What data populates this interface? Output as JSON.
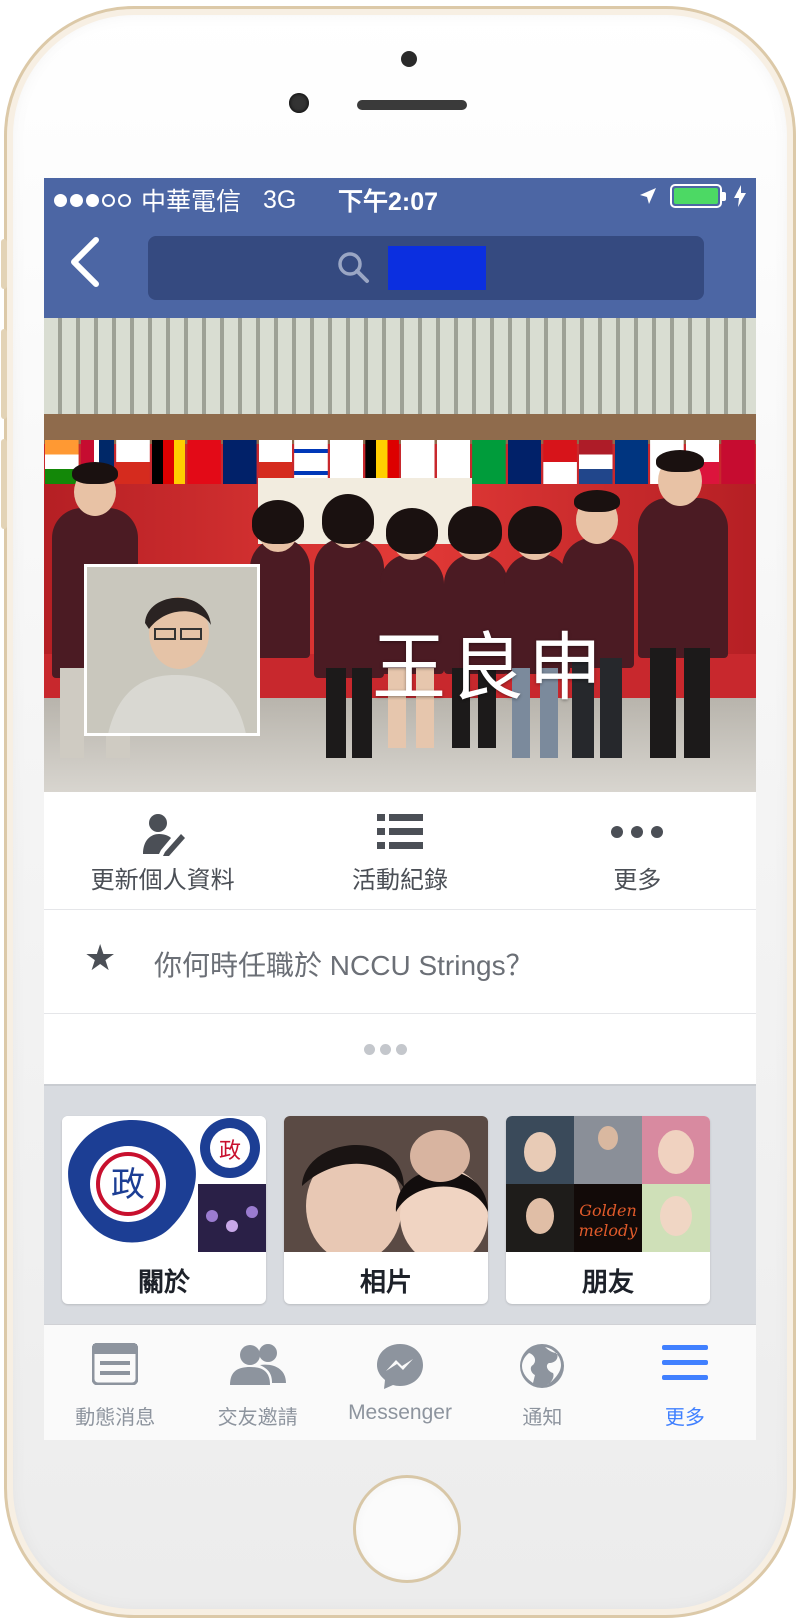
{
  "status_bar": {
    "carrier": "中華電信",
    "network": "3G",
    "time": "下午2:07",
    "signal_bars_filled": 3,
    "signal_bars_total": 5,
    "battery_level": 1.0
  },
  "nav": {
    "back_icon": "chevron-left-icon",
    "search_icon": "search-icon"
  },
  "profile": {
    "name": "王良申"
  },
  "actions": [
    {
      "icon": "edit-profile-icon",
      "label": "更新個人資料"
    },
    {
      "icon": "list-icon",
      "label": "活動紀錄"
    },
    {
      "icon": "more-dots-icon",
      "label": "更多"
    }
  ],
  "question": {
    "icon": "star-icon",
    "text": "你何時任職於 NCCU Strings？"
  },
  "tiles": [
    {
      "label": "關於"
    },
    {
      "label": "相片"
    },
    {
      "label": "朋友"
    }
  ],
  "tabbar": [
    {
      "icon": "news-feed-icon",
      "label": "動態消息",
      "active": false
    },
    {
      "icon": "friend-requests-icon",
      "label": "交友邀請",
      "active": false
    },
    {
      "icon": "messenger-icon",
      "label": "Messenger",
      "active": false
    },
    {
      "icon": "globe-icon",
      "label": "通知",
      "active": false
    },
    {
      "icon": "menu-icon",
      "label": "更多",
      "active": true
    }
  ],
  "colors": {
    "brand": "#4c66a4",
    "active_tab": "#4080ff",
    "battery": "#4cd964"
  }
}
